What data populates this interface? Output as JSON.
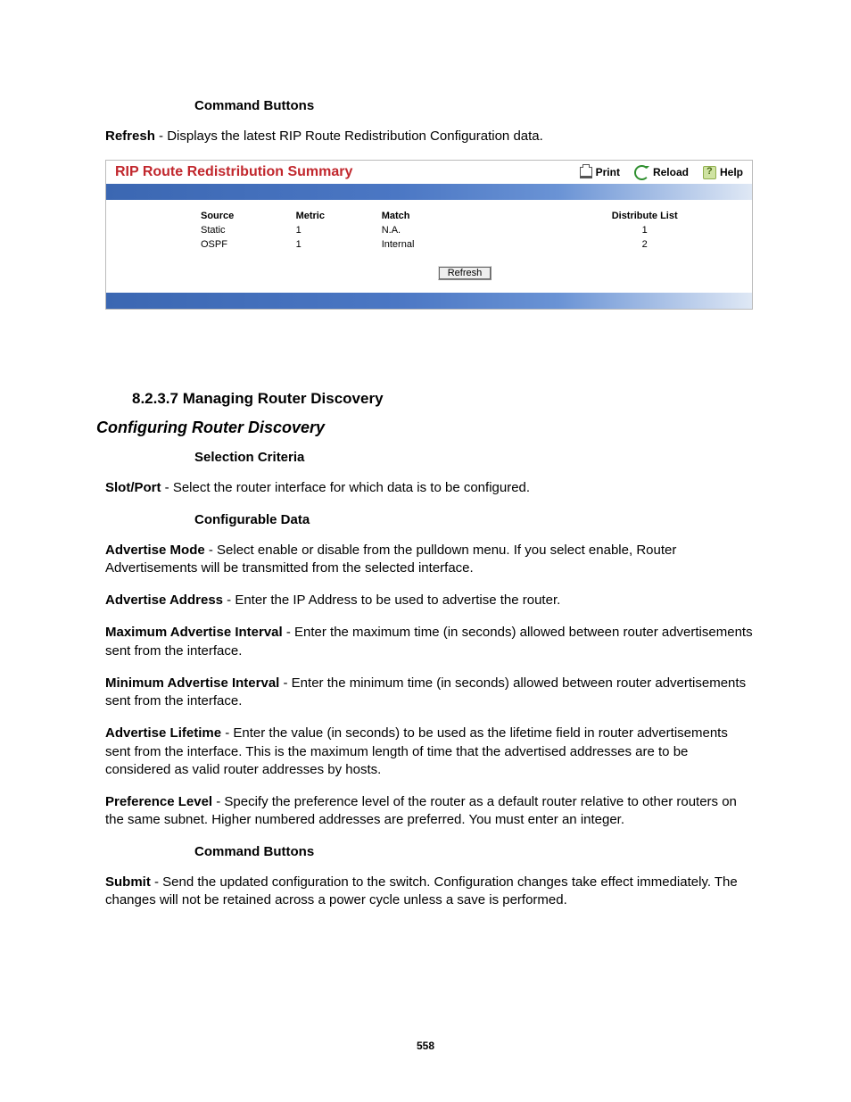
{
  "doc": {
    "cmd_buttons_label": "Command Buttons",
    "refresh_name": "Refresh",
    "refresh_desc": " - Displays the latest RIP Route Redistribution Configuration data."
  },
  "panel": {
    "title": "RIP Route Redistribution Summary",
    "tools": {
      "print": "Print",
      "reload": "Reload",
      "help": "Help"
    },
    "columns": {
      "source": "Source",
      "metric": "Metric",
      "match": "Match",
      "distribute": "Distribute List"
    },
    "rows": [
      {
        "source": "Static",
        "metric": "1",
        "match": "N.A.",
        "distribute": "1"
      },
      {
        "source": "OSPF",
        "metric": "1",
        "match": "Internal",
        "distribute": "2"
      }
    ],
    "refresh_btn": "Refresh"
  },
  "sec": {
    "num_title": "8.2.3.7 Managing Router Discovery",
    "sub_title": "Configuring Router Discovery",
    "selection_criteria": "Selection Criteria",
    "slotport_name": "Slot/Port",
    "slotport_desc": " - Select the router interface for which data is to be configured.",
    "configurable_data": "Configurable Data",
    "adv_mode_name": "Advertise Mode",
    "adv_mode_desc": " - Select enable or disable from the pulldown menu. If you select enable, Router Advertisements will be transmitted from the selected interface.",
    "adv_addr_name": "Advertise Address",
    "adv_addr_desc": " - Enter the IP Address to be used to advertise the router.",
    "max_int_name": "Maximum Advertise Interval",
    "max_int_desc": " - Enter the maximum time (in seconds) allowed between router advertisements sent from the interface.",
    "min_int_name": "Minimum Advertise Interval",
    "min_int_desc": " - Enter the minimum time (in seconds) allowed between router advertisements sent from the interface.",
    "adv_life_name": "Advertise Lifetime",
    "adv_life_desc": " - Enter the value (in seconds) to be used as the lifetime field in router advertisements sent from the interface. This is the maximum length of time that the advertised addresses are to be considered as valid router addresses by hosts.",
    "pref_name": "Preference Level",
    "pref_desc": " - Specify the preference level of the router as a default router relative to other routers on the same subnet. Higher numbered addresses are preferred. You must enter an integer.",
    "cmd_buttons2": "Command Buttons",
    "submit_name": "Submit",
    "submit_desc": " - Send the updated configuration to the switch. Configuration changes take effect immediately. The changes will not be retained across a power cycle unless a save is performed."
  },
  "page_number": "558"
}
